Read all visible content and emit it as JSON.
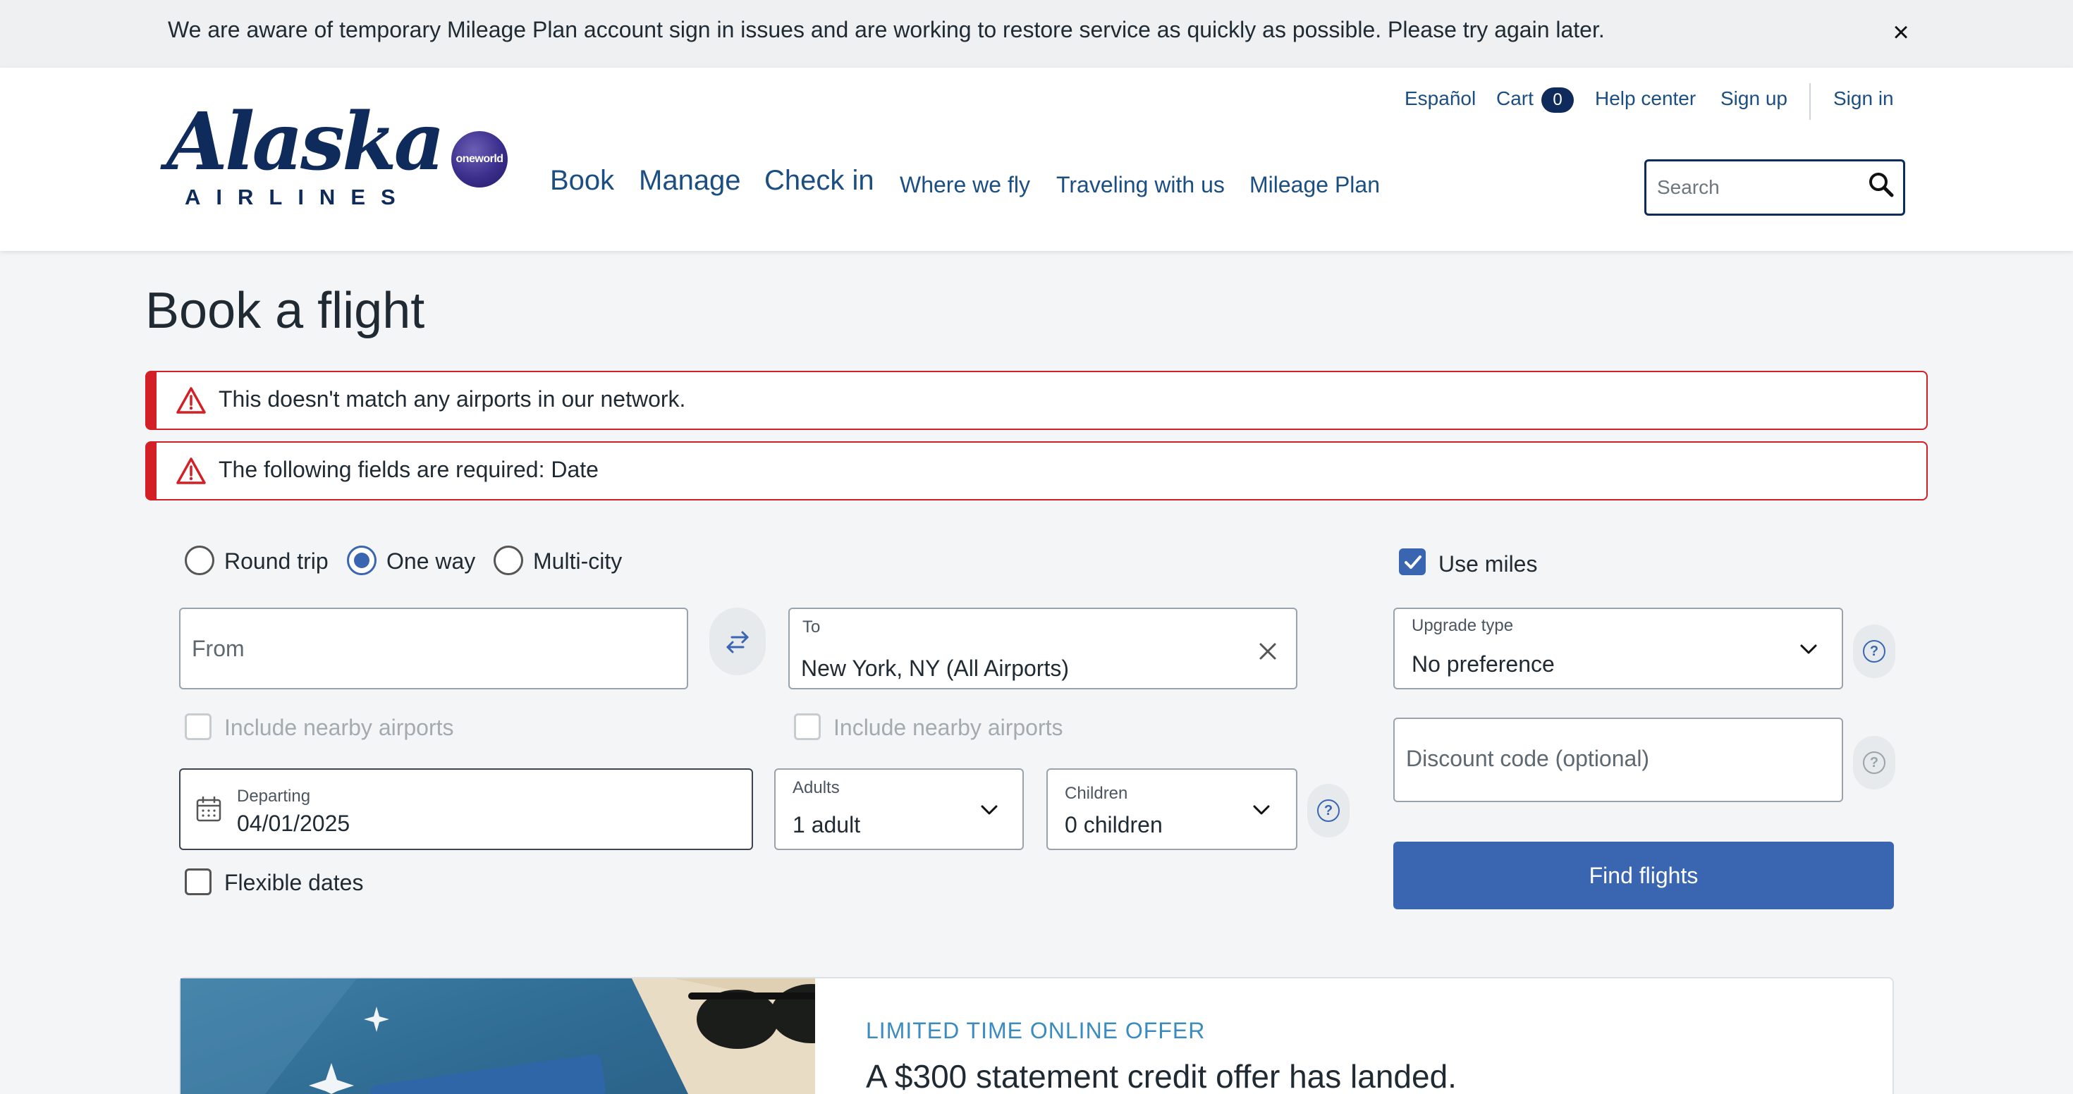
{
  "banner": {
    "message": "We are aware of temporary Mileage Plan account sign in issues and are working to restore service as quickly as possible. Please try again later.",
    "close_icon": "close-icon"
  },
  "header": {
    "logo": {
      "wordmark": "Alaska",
      "subtitle": "AIRLINES"
    },
    "oneworld_badge": "oneworld",
    "utility_links": {
      "language": "Español",
      "cart_label": "Cart",
      "cart_count": "0",
      "help": "Help center",
      "signup": "Sign up",
      "signin": "Sign in"
    },
    "nav": {
      "book": "Book",
      "manage": "Manage",
      "checkin": "Check in",
      "where_we_fly": "Where we fly",
      "traveling": "Traveling with us",
      "mileage": "Mileage Plan"
    },
    "search": {
      "placeholder": "Search",
      "icon": "search-icon"
    }
  },
  "page": {
    "title": "Book a flight",
    "errors": [
      "This doesn't match any airports in our network.",
      "The following fields are required: Date"
    ]
  },
  "form": {
    "trip_types": [
      {
        "label": "Round trip",
        "checked": false
      },
      {
        "label": "One way",
        "checked": true
      },
      {
        "label": "Multi-city",
        "checked": false
      }
    ],
    "use_miles": {
      "label": "Use miles",
      "checked": true
    },
    "from": {
      "placeholder": "From",
      "value": ""
    },
    "to": {
      "label": "To",
      "value": "New York, NY (All Airports)"
    },
    "nearby_from": "Include nearby airports",
    "nearby_to": "Include nearby airports",
    "departing": {
      "label": "Departing",
      "value": "04/01/2025"
    },
    "adults": {
      "label": "Adults",
      "value": "1 adult"
    },
    "children": {
      "label": "Children",
      "value": "0 children"
    },
    "flexible_dates": "Flexible dates",
    "upgrade": {
      "label": "Upgrade type",
      "value": "No preference"
    },
    "discount": {
      "placeholder": "Discount code (optional)"
    },
    "find_button": "Find flights",
    "help_glyph": "?"
  },
  "promo": {
    "eyebrow": "LIMITED TIME ONLINE OFFER",
    "title": "A $300 statement credit offer has landed."
  },
  "colors": {
    "brand_navy": "#0f2b5b",
    "link_blue": "#1b4e82",
    "primary_button": "#3a66b1",
    "error_red": "#d32027"
  }
}
